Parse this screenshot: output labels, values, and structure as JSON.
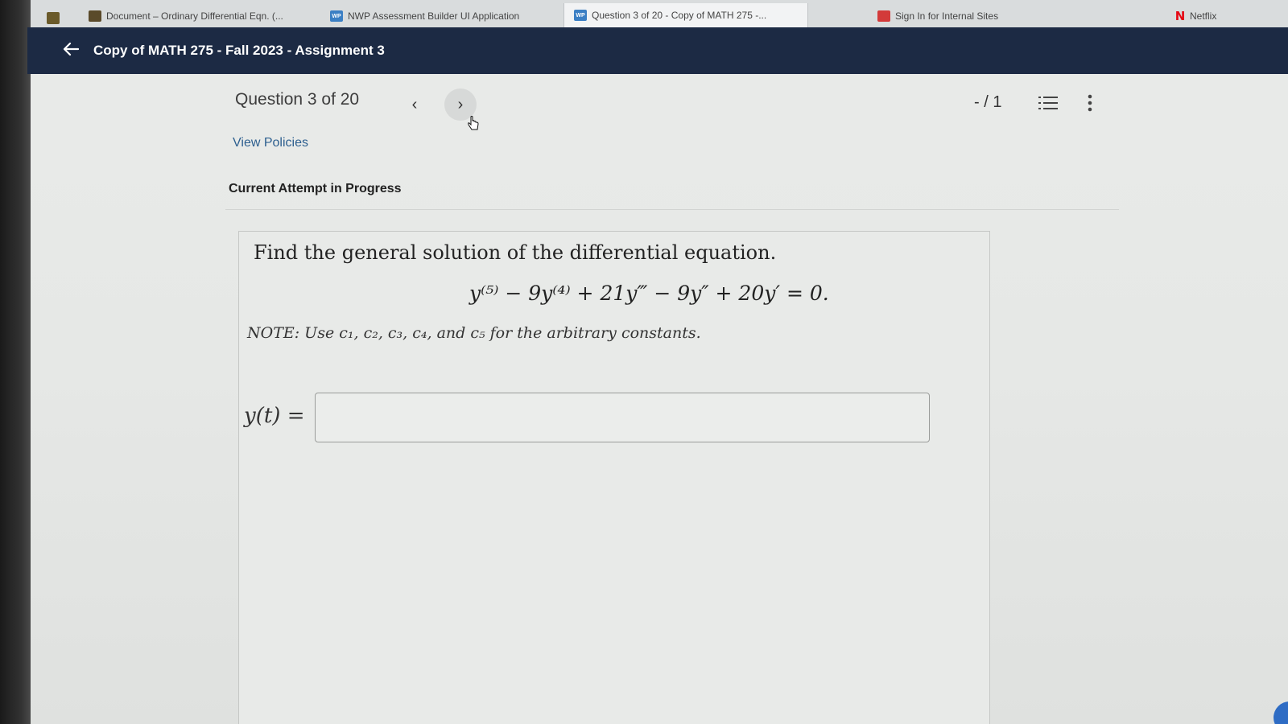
{
  "tabs": [
    {
      "label": "Document – Ordinary Differential Eqn. (...",
      "icon": "doc-app-icon"
    },
    {
      "label": "NWP Assessment Builder UI Application",
      "icon": "wp-icon",
      "icon_text": "WP"
    },
    {
      "label": "Question 3 of 20 - Copy of MATH 275 -...",
      "icon": "wp-icon",
      "icon_text": "WP"
    },
    {
      "label": "Sign In for Internal Sites",
      "icon": "sign-in-icon"
    },
    {
      "label": "Netflix",
      "icon": "netflix-icon",
      "icon_text": "N"
    }
  ],
  "header": {
    "back_icon": "arrow-left-icon",
    "title": "Copy of MATH 275 - Fall 2023 - Assignment 3"
  },
  "question_nav": {
    "label": "Question 3 of 20",
    "prev_symbol": "‹",
    "next_symbol": "›",
    "score": "- / 1"
  },
  "links": {
    "view_policies": "View Policies"
  },
  "attempt": {
    "label": "Current Attempt in Progress"
  },
  "question": {
    "prompt": "Find the general solution of the differential equation.",
    "equation": "y⁽⁵⁾ − 9y⁽⁴⁾ + 21y‴ − 9y″ + 20y′ = 0.",
    "note": "NOTE: Use c₁, c₂, c₃, c₄, and c₅ for the arbitrary constants.",
    "answer_label": "y(t) =",
    "answer_value": ""
  },
  "colors": {
    "header_bg": "#1c2a44",
    "link": "#2d5f8f",
    "page_bg": "#e9ebe9"
  }
}
